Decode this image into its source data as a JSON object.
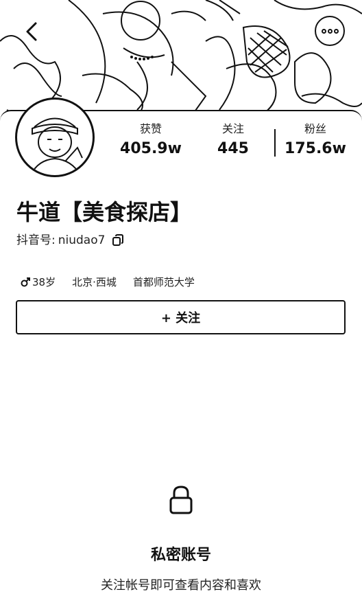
{
  "profile": {
    "name": "牛道【美食探店】",
    "id_label": "抖音号:",
    "id_value": "niudao7",
    "stats": [
      {
        "label": "获赞",
        "value": "405.9w"
      },
      {
        "label": "关注",
        "value": "445"
      },
      {
        "label": "粉丝",
        "value": "175.6w"
      }
    ],
    "tags": {
      "age": "38岁",
      "location": "北京·西城",
      "school": "首都师范大学"
    },
    "gender_icon": "male-icon"
  },
  "actions": {
    "follow_label": "+ 关注"
  },
  "private": {
    "title": "私密账号",
    "description": "关注帐号即可查看内容和喜欢"
  },
  "icons": {
    "back": "back-arrow-icon",
    "more": "more-icon",
    "copy": "copy-icon",
    "lock": "lock-icon"
  }
}
